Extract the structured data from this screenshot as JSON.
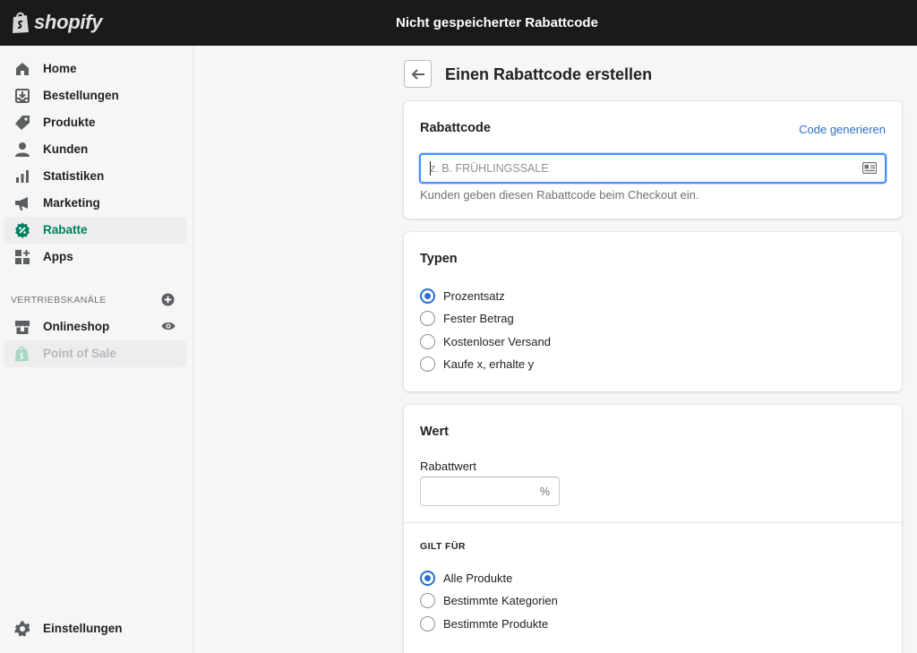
{
  "app": {
    "brand": "shopify",
    "window_title": "Nicht gespeicherter Rabattcode"
  },
  "sidebar": {
    "items": [
      {
        "label": "Home",
        "icon": "home-icon"
      },
      {
        "label": "Bestellungen",
        "icon": "orders-icon"
      },
      {
        "label": "Produkte",
        "icon": "tag-icon"
      },
      {
        "label": "Kunden",
        "icon": "person-icon"
      },
      {
        "label": "Statistiken",
        "icon": "bar-chart-icon"
      },
      {
        "label": "Marketing",
        "icon": "megaphone-icon"
      },
      {
        "label": "Rabatte",
        "icon": "discount-icon",
        "active": true
      },
      {
        "label": "Apps",
        "icon": "apps-icon"
      }
    ],
    "channels_title": "VERTRIEBSKANÄLE",
    "channels": [
      {
        "label": "Onlineshop",
        "icon": "store-icon"
      },
      {
        "label": "Point of Sale",
        "icon": "shopify-bag-icon",
        "disabled": true
      }
    ],
    "settings_label": "Einstellungen"
  },
  "page": {
    "title": "Einen Rabattcode erstellen"
  },
  "code_card": {
    "title": "Rabattcode",
    "generate_link": "Code generieren",
    "input_value": "",
    "input_placeholder": "z. B. FRÜHLINGSSALE",
    "help_text": "Kunden geben diesen Rabattcode beim Checkout ein."
  },
  "types_card": {
    "title": "Typen",
    "options": [
      {
        "label": "Prozentsatz",
        "checked": true
      },
      {
        "label": "Fester Betrag",
        "checked": false
      },
      {
        "label": "Kostenloser Versand",
        "checked": false
      },
      {
        "label": "Kaufe x, erhalte y",
        "checked": false
      }
    ]
  },
  "value_card": {
    "title": "Wert",
    "field_label": "Rabattwert",
    "field_value": "",
    "suffix": "%",
    "applies_title": "GILT FÜR",
    "applies_options": [
      {
        "label": "Alle Produkte",
        "checked": true
      },
      {
        "label": "Bestimmte Kategorien",
        "checked": false
      },
      {
        "label": "Bestimmte Produkte",
        "checked": false
      }
    ]
  },
  "colors": {
    "topbar": "#1a1a1a",
    "accent_green": "#007f5f",
    "link_blue": "#2c6ecb",
    "focus_blue": "#458fff"
  }
}
